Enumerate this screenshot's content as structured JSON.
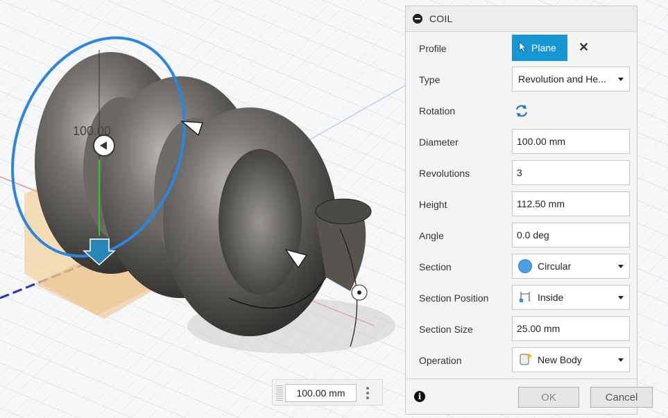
{
  "dialog": {
    "title": "COIL",
    "fields": {
      "profile": {
        "label": "Profile",
        "button": "Plane"
      },
      "type": {
        "label": "Type",
        "value": "Revolution and He..."
      },
      "rotation": {
        "label": "Rotation"
      },
      "diameter": {
        "label": "Diameter",
        "value": "100.00 mm"
      },
      "revolutions": {
        "label": "Revolutions",
        "value": "3"
      },
      "height": {
        "label": "Height",
        "value": "112.50 mm"
      },
      "angle": {
        "label": "Angle",
        "value": "0.0 deg"
      },
      "section": {
        "label": "Section",
        "value": "Circular"
      },
      "section_position": {
        "label": "Section Position",
        "value": "Inside"
      },
      "section_size": {
        "label": "Section Size",
        "value": "25.00 mm"
      },
      "operation": {
        "label": "Operation",
        "value": "New Body"
      }
    },
    "footer": {
      "ok": "OK",
      "cancel": "Cancel"
    }
  },
  "canvas": {
    "dimension_label": "100.00",
    "measurement": "100.00 mm"
  },
  "colors": {
    "accent": "#1696d2",
    "coil": "#6e6c68",
    "profile_circle": "#2a86e0",
    "plane": "#f1c98b"
  },
  "icons": {
    "collapse": "collapse-icon",
    "cursor": "cursor-arrow-icon",
    "clear": "close-icon",
    "rotation": "rotate-icon",
    "section": "circle-section-icon",
    "section_position": "inside-position-icon",
    "operation": "new-body-icon",
    "info": "info-icon"
  }
}
